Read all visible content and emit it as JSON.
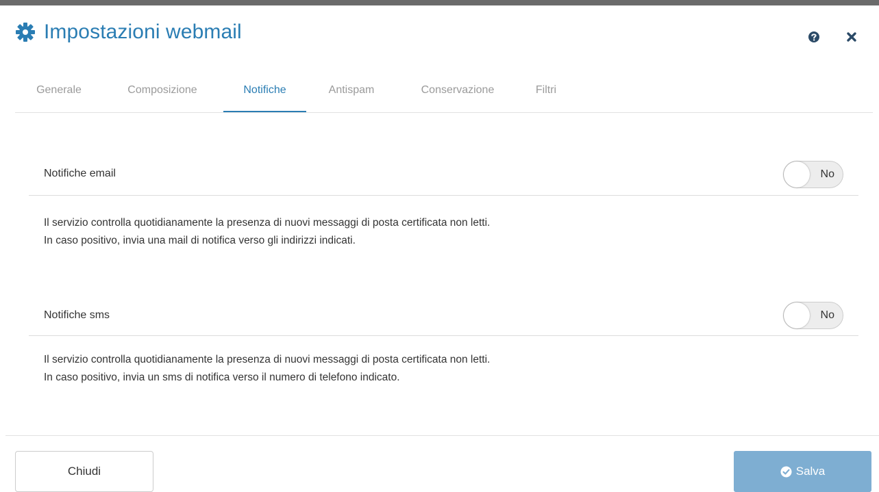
{
  "window": {
    "title": "Impostazioni webmail",
    "title_icon": "gear-icon",
    "help_icon": "question-circle-icon",
    "close_icon": "close-icon"
  },
  "tabs": [
    {
      "label": "Generale",
      "active": false
    },
    {
      "label": "Composizione",
      "active": false
    },
    {
      "label": "Notifiche",
      "active": true
    },
    {
      "label": "Antispam",
      "active": false
    },
    {
      "label": "Conservazione",
      "active": false
    },
    {
      "label": "Filtri",
      "active": false
    }
  ],
  "notifications": {
    "email": {
      "label": "Notifiche email",
      "toggle_text": "No",
      "enabled": false,
      "description_line1": "Il servizio controlla quotidianamente la presenza di nuovi messaggi di posta certificata non letti.",
      "description_line2": "In caso positivo, invia una mail di notifica verso gli indirizzi indicati."
    },
    "sms": {
      "label": "Notifiche sms",
      "toggle_text": "No",
      "enabled": false,
      "description_line1": "Il servizio controlla quotidianamente la presenza di nuovi messaggi di posta certificata non letti.",
      "description_line2": "In caso positivo, invia un sms di notifica verso il numero di telefono indicato."
    }
  },
  "footer": {
    "close_label": "Chiudi",
    "save_label": "Salva",
    "save_icon": "check-circle-icon"
  },
  "colors": {
    "accent": "#2a7db3",
    "save_button": "#7eaed2",
    "inactive_tab": "#9a9a9a"
  }
}
